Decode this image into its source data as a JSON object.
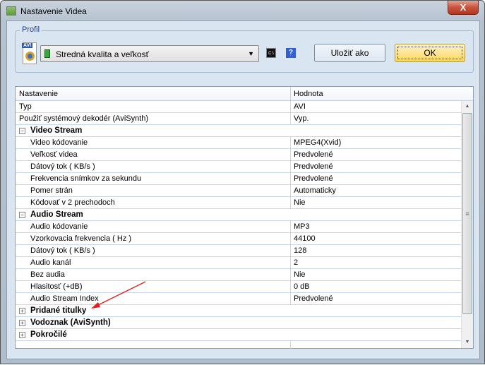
{
  "window": {
    "title": "Nastavenie Videa",
    "close": "X"
  },
  "profile": {
    "group_label": "Profil",
    "selected": "Stredná kvalita a veľkosť",
    "save_as": "Uložiť ako",
    "ok": "OK",
    "help": "?",
    "cmd": "C:\\"
  },
  "grid": {
    "headers": [
      "Nastavenie",
      "Hodnota"
    ],
    "rows": [
      {
        "name": "Typ",
        "value": "AVI"
      },
      {
        "name": "Použiť systémový dekodér (AviSynth)",
        "value": "Vyp."
      },
      {
        "group": "Video Stream",
        "expanded": "⊟"
      },
      {
        "name": "Video kódovanie",
        "value": "MPEG4(Xvid)"
      },
      {
        "name": "Veľkosť videa",
        "value": "Predvolené"
      },
      {
        "name": "Dátový tok ( KB/s )",
        "value": "Predvolené"
      },
      {
        "name": "Frekvencia snímkov za sekundu",
        "value": "Predvolené"
      },
      {
        "name": "Pomer strán",
        "value": "Automaticky"
      },
      {
        "name": "Kódovať v 2 prechodoch",
        "value": "Nie"
      },
      {
        "group": "Audio Stream"
      },
      {
        "name": "Audio kódovanie",
        "value": "MP3"
      },
      {
        "name": "Vzorkovacia frekvencia ( Hz )",
        "value": "44100"
      },
      {
        "name": "Dátový tok ( KB/s )",
        "value": "128"
      },
      {
        "name": "Audio kanál",
        "value": "2"
      },
      {
        "name": "Bez audia",
        "value": "Nie"
      },
      {
        "name": "Hlasitosť (+dB)",
        "value": "0 dB"
      },
      {
        "name": "Audio Stream Index",
        "value": "Predvolené"
      },
      {
        "group": "Pridané titulky"
      },
      {
        "group": "Vodoznak (AviSynth)"
      },
      {
        "group": "Pokročilé"
      }
    ]
  },
  "annotation_color": "#e02020"
}
